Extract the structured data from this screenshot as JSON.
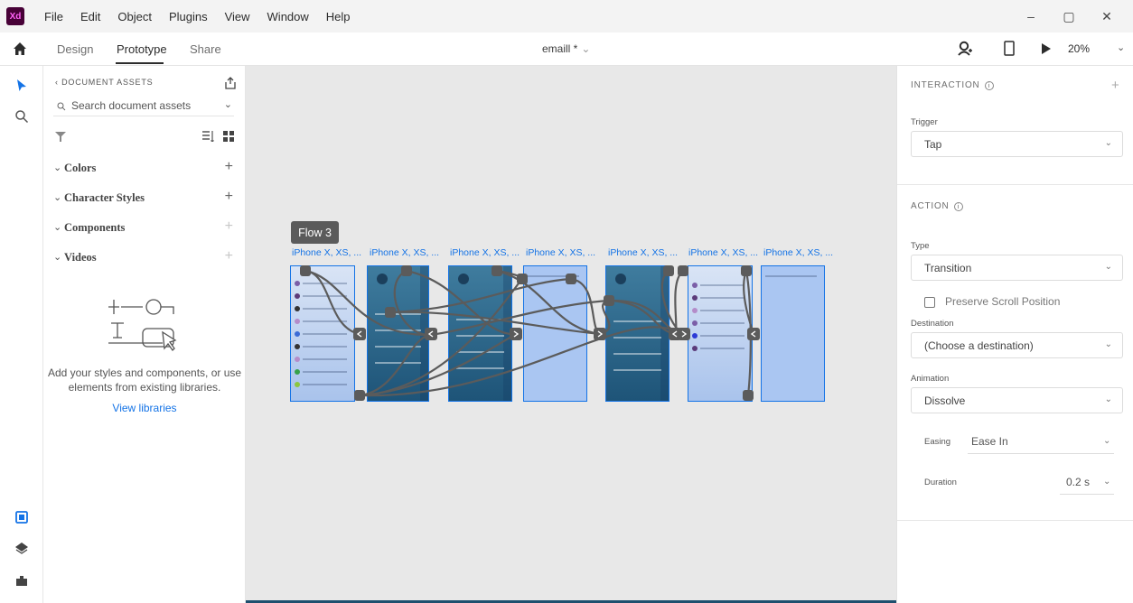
{
  "app": {
    "logo_text": "Xd",
    "brand_color": "#470137"
  },
  "menu": [
    "File",
    "Edit",
    "Object",
    "Plugins",
    "View",
    "Window",
    "Help"
  ],
  "window_controls": {
    "minimize": "–",
    "restore": "▢",
    "close": "✕"
  },
  "tabs": {
    "design": "Design",
    "prototype": "Prototype",
    "share": "Share"
  },
  "document": {
    "title": "emaill *",
    "chevron": "⌄"
  },
  "toolbar_right": {
    "zoom": "20%",
    "zoom_chevron": "⌄"
  },
  "assets": {
    "header": "‹ DOCUMENT ASSETS",
    "search_placeholder": "Search document assets",
    "sections": [
      {
        "label": "Colors",
        "plus": "+"
      },
      {
        "label": "Character Styles",
        "plus": "+"
      },
      {
        "label": "Components",
        "plus": "+"
      },
      {
        "label": "Videos",
        "plus": "+"
      }
    ],
    "empty_text": "Add your styles and components, or use elements from existing libraries.",
    "view_libraries": "View libraries"
  },
  "canvas": {
    "flow_label": "Flow 3",
    "artboards": [
      {
        "label": "iPhone X, XS, ..."
      },
      {
        "label": "iPhone X, XS, ..."
      },
      {
        "label": "iPhone X, XS, ..."
      },
      {
        "label": "iPhone X, XS, ..."
      },
      {
        "label": "iPhone X, XS, ..."
      },
      {
        "label": "iPhone X, XS, ..."
      },
      {
        "label": "iPhone X, XS, ..."
      }
    ]
  },
  "interaction": {
    "header": "INTERACTION",
    "trigger_label": "Trigger",
    "trigger_value": "Tap",
    "action_header": "ACTION",
    "type_label": "Type",
    "type_value": "Transition",
    "preserve_scroll": "Preserve Scroll Position",
    "destination_label": "Destination",
    "destination_value": "(Choose a destination)",
    "animation_label": "Animation",
    "animation_value": "Dissolve",
    "easing_label": "Easing",
    "easing_value": "Ease In",
    "duration_label": "Duration",
    "duration_value": "0.2 s"
  },
  "colors": {
    "accent": "#1473e6",
    "canvas": "#e8e8e8",
    "wire": "#5b5b5b"
  }
}
